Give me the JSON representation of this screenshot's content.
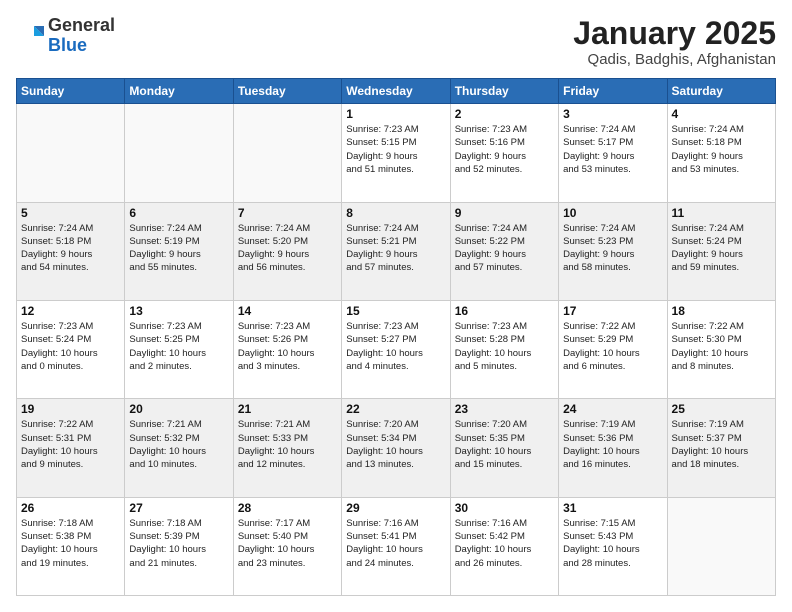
{
  "header": {
    "logo_general": "General",
    "logo_blue": "Blue",
    "month_year": "January 2025",
    "location": "Qadis, Badghis, Afghanistan"
  },
  "days_of_week": [
    "Sunday",
    "Monday",
    "Tuesday",
    "Wednesday",
    "Thursday",
    "Friday",
    "Saturday"
  ],
  "weeks": [
    [
      {
        "day": "",
        "detail": ""
      },
      {
        "day": "",
        "detail": ""
      },
      {
        "day": "",
        "detail": ""
      },
      {
        "day": "1",
        "detail": "Sunrise: 7:23 AM\nSunset: 5:15 PM\nDaylight: 9 hours\nand 51 minutes."
      },
      {
        "day": "2",
        "detail": "Sunrise: 7:23 AM\nSunset: 5:16 PM\nDaylight: 9 hours\nand 52 minutes."
      },
      {
        "day": "3",
        "detail": "Sunrise: 7:24 AM\nSunset: 5:17 PM\nDaylight: 9 hours\nand 53 minutes."
      },
      {
        "day": "4",
        "detail": "Sunrise: 7:24 AM\nSunset: 5:18 PM\nDaylight: 9 hours\nand 53 minutes."
      }
    ],
    [
      {
        "day": "5",
        "detail": "Sunrise: 7:24 AM\nSunset: 5:18 PM\nDaylight: 9 hours\nand 54 minutes."
      },
      {
        "day": "6",
        "detail": "Sunrise: 7:24 AM\nSunset: 5:19 PM\nDaylight: 9 hours\nand 55 minutes."
      },
      {
        "day": "7",
        "detail": "Sunrise: 7:24 AM\nSunset: 5:20 PM\nDaylight: 9 hours\nand 56 minutes."
      },
      {
        "day": "8",
        "detail": "Sunrise: 7:24 AM\nSunset: 5:21 PM\nDaylight: 9 hours\nand 57 minutes."
      },
      {
        "day": "9",
        "detail": "Sunrise: 7:24 AM\nSunset: 5:22 PM\nDaylight: 9 hours\nand 57 minutes."
      },
      {
        "day": "10",
        "detail": "Sunrise: 7:24 AM\nSunset: 5:23 PM\nDaylight: 9 hours\nand 58 minutes."
      },
      {
        "day": "11",
        "detail": "Sunrise: 7:24 AM\nSunset: 5:24 PM\nDaylight: 9 hours\nand 59 minutes."
      }
    ],
    [
      {
        "day": "12",
        "detail": "Sunrise: 7:23 AM\nSunset: 5:24 PM\nDaylight: 10 hours\nand 0 minutes."
      },
      {
        "day": "13",
        "detail": "Sunrise: 7:23 AM\nSunset: 5:25 PM\nDaylight: 10 hours\nand 2 minutes."
      },
      {
        "day": "14",
        "detail": "Sunrise: 7:23 AM\nSunset: 5:26 PM\nDaylight: 10 hours\nand 3 minutes."
      },
      {
        "day": "15",
        "detail": "Sunrise: 7:23 AM\nSunset: 5:27 PM\nDaylight: 10 hours\nand 4 minutes."
      },
      {
        "day": "16",
        "detail": "Sunrise: 7:23 AM\nSunset: 5:28 PM\nDaylight: 10 hours\nand 5 minutes."
      },
      {
        "day": "17",
        "detail": "Sunrise: 7:22 AM\nSunset: 5:29 PM\nDaylight: 10 hours\nand 6 minutes."
      },
      {
        "day": "18",
        "detail": "Sunrise: 7:22 AM\nSunset: 5:30 PM\nDaylight: 10 hours\nand 8 minutes."
      }
    ],
    [
      {
        "day": "19",
        "detail": "Sunrise: 7:22 AM\nSunset: 5:31 PM\nDaylight: 10 hours\nand 9 minutes."
      },
      {
        "day": "20",
        "detail": "Sunrise: 7:21 AM\nSunset: 5:32 PM\nDaylight: 10 hours\nand 10 minutes."
      },
      {
        "day": "21",
        "detail": "Sunrise: 7:21 AM\nSunset: 5:33 PM\nDaylight: 10 hours\nand 12 minutes."
      },
      {
        "day": "22",
        "detail": "Sunrise: 7:20 AM\nSunset: 5:34 PM\nDaylight: 10 hours\nand 13 minutes."
      },
      {
        "day": "23",
        "detail": "Sunrise: 7:20 AM\nSunset: 5:35 PM\nDaylight: 10 hours\nand 15 minutes."
      },
      {
        "day": "24",
        "detail": "Sunrise: 7:19 AM\nSunset: 5:36 PM\nDaylight: 10 hours\nand 16 minutes."
      },
      {
        "day": "25",
        "detail": "Sunrise: 7:19 AM\nSunset: 5:37 PM\nDaylight: 10 hours\nand 18 minutes."
      }
    ],
    [
      {
        "day": "26",
        "detail": "Sunrise: 7:18 AM\nSunset: 5:38 PM\nDaylight: 10 hours\nand 19 minutes."
      },
      {
        "day": "27",
        "detail": "Sunrise: 7:18 AM\nSunset: 5:39 PM\nDaylight: 10 hours\nand 21 minutes."
      },
      {
        "day": "28",
        "detail": "Sunrise: 7:17 AM\nSunset: 5:40 PM\nDaylight: 10 hours\nand 23 minutes."
      },
      {
        "day": "29",
        "detail": "Sunrise: 7:16 AM\nSunset: 5:41 PM\nDaylight: 10 hours\nand 24 minutes."
      },
      {
        "day": "30",
        "detail": "Sunrise: 7:16 AM\nSunset: 5:42 PM\nDaylight: 10 hours\nand 26 minutes."
      },
      {
        "day": "31",
        "detail": "Sunrise: 7:15 AM\nSunset: 5:43 PM\nDaylight: 10 hours\nand 28 minutes."
      },
      {
        "day": "",
        "detail": ""
      }
    ]
  ],
  "alt_row_indices": [
    1,
    3
  ]
}
